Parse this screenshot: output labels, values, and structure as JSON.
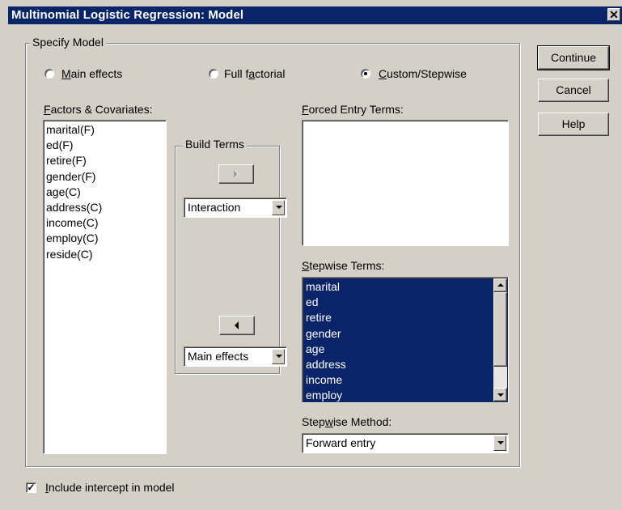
{
  "window": {
    "title": "Multinomial Logistic Regression: Model",
    "close_glyph": "✕"
  },
  "specify_model": {
    "label": "Specify Model",
    "options": [
      {
        "pre": "",
        "key": "M",
        "post": "ain effects",
        "selected": false
      },
      {
        "pre": "Full f",
        "key": "a",
        "post": "ctorial",
        "selected": false
      },
      {
        "pre": "",
        "key": "C",
        "post": "ustom/Stepwise",
        "selected": true
      }
    ]
  },
  "factors": {
    "label_key": "F",
    "label_rest": "actors & Covariates:",
    "items": [
      "marital(F)",
      "ed(F)",
      "retire(F)",
      "gender(F)",
      "age(C)",
      "address(C)",
      "income(C)",
      "employ(C)",
      "reside(C)"
    ]
  },
  "build_terms": {
    "label": "Build Terms",
    "combo_top": "Interaction",
    "combo_bottom": "Main effects"
  },
  "forced_entry": {
    "label_key": "F",
    "label_rest": "orced Entry Terms:",
    "items": []
  },
  "stepwise_terms": {
    "label_key": "S",
    "label_rest": "tepwise Terms:",
    "items": [
      "marital",
      "ed",
      "retire",
      "gender",
      "age",
      "address",
      "income",
      "employ"
    ],
    "selection_color": "#0a246a"
  },
  "stepwise_method": {
    "label_pre": "Step",
    "label_key": "w",
    "label_post": "ise Method:",
    "value": "Forward entry"
  },
  "buttons": {
    "continue": "Continue",
    "cancel": "Cancel",
    "help": "Help"
  },
  "intercept": {
    "checked": true,
    "check_glyph": "✓",
    "label_key": "I",
    "label_rest": "nclude intercept in model"
  },
  "colors": {
    "dialog_bg": "#d4d0c8",
    "titlebar": "#0a246a",
    "selection": "#0a246a"
  }
}
